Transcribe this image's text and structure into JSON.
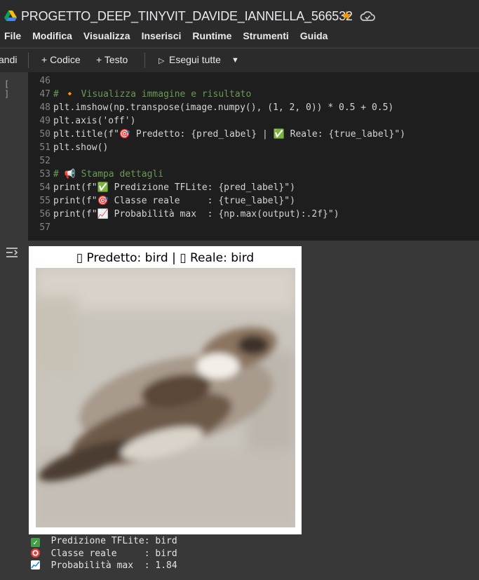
{
  "window": {
    "title": "PROGETTO_DEEP_TINYVIT_DAVIDE_IANNELLA_566532",
    "icons": [
      "drive-icon",
      "star-icon",
      "cloud-icon"
    ]
  },
  "menu": [
    "File",
    "Modifica",
    "Visualizza",
    "Inserisci",
    "Runtime",
    "Strumenti",
    "Guida"
  ],
  "toolbar": {
    "commands_label": "andi",
    "add_code_label": "+ Codice",
    "add_text_label": "+ Testo",
    "run_all_label": "Esegui tutte"
  },
  "code_cell": {
    "run_indicator": "[ ]",
    "lines": [
      {
        "n": "46",
        "text": ""
      },
      {
        "n": "47",
        "text": "# 🔸 Visualizza immagine e risultato"
      },
      {
        "n": "48",
        "text": "plt.imshow(np.transpose(image.numpy(), (1, 2, 0)) * 0.5 + 0.5)"
      },
      {
        "n": "49",
        "text": "plt.axis('off')"
      },
      {
        "n": "50",
        "text": "plt.title(f\"🎯 Predetto: {pred_label} | ✅ Reale: {true_label}\")"
      },
      {
        "n": "51",
        "text": "plt.show()"
      },
      {
        "n": "52",
        "text": ""
      },
      {
        "n": "53",
        "text": "# 📢 Stampa dettagli"
      },
      {
        "n": "54",
        "text": "print(f\"✅ Predizione TFLite: {pred_label}\")"
      },
      {
        "n": "55",
        "text": "print(f\"🎯 Classe reale     : {true_label}\")"
      },
      {
        "n": "56",
        "text": "print(f\"📈 Probabilità max  : {np.max(output):.2f}\")"
      },
      {
        "n": "57",
        "text": ""
      }
    ]
  },
  "output": {
    "figure_title": "▯ Predetto: bird | ▯ Reale: bird",
    "lines": [
      {
        "icon": "check-emoji",
        "text": "Predizione TFLite: bird"
      },
      {
        "icon": "target-emoji",
        "text": "Classe reale     : bird"
      },
      {
        "icon": "chart-emoji",
        "text": "Probabilità max  : 1.84"
      }
    ]
  },
  "colors": {
    "background": "#383838",
    "editor_bg": "#1e1e1e",
    "star": "#f29900",
    "check": "#43a047"
  }
}
